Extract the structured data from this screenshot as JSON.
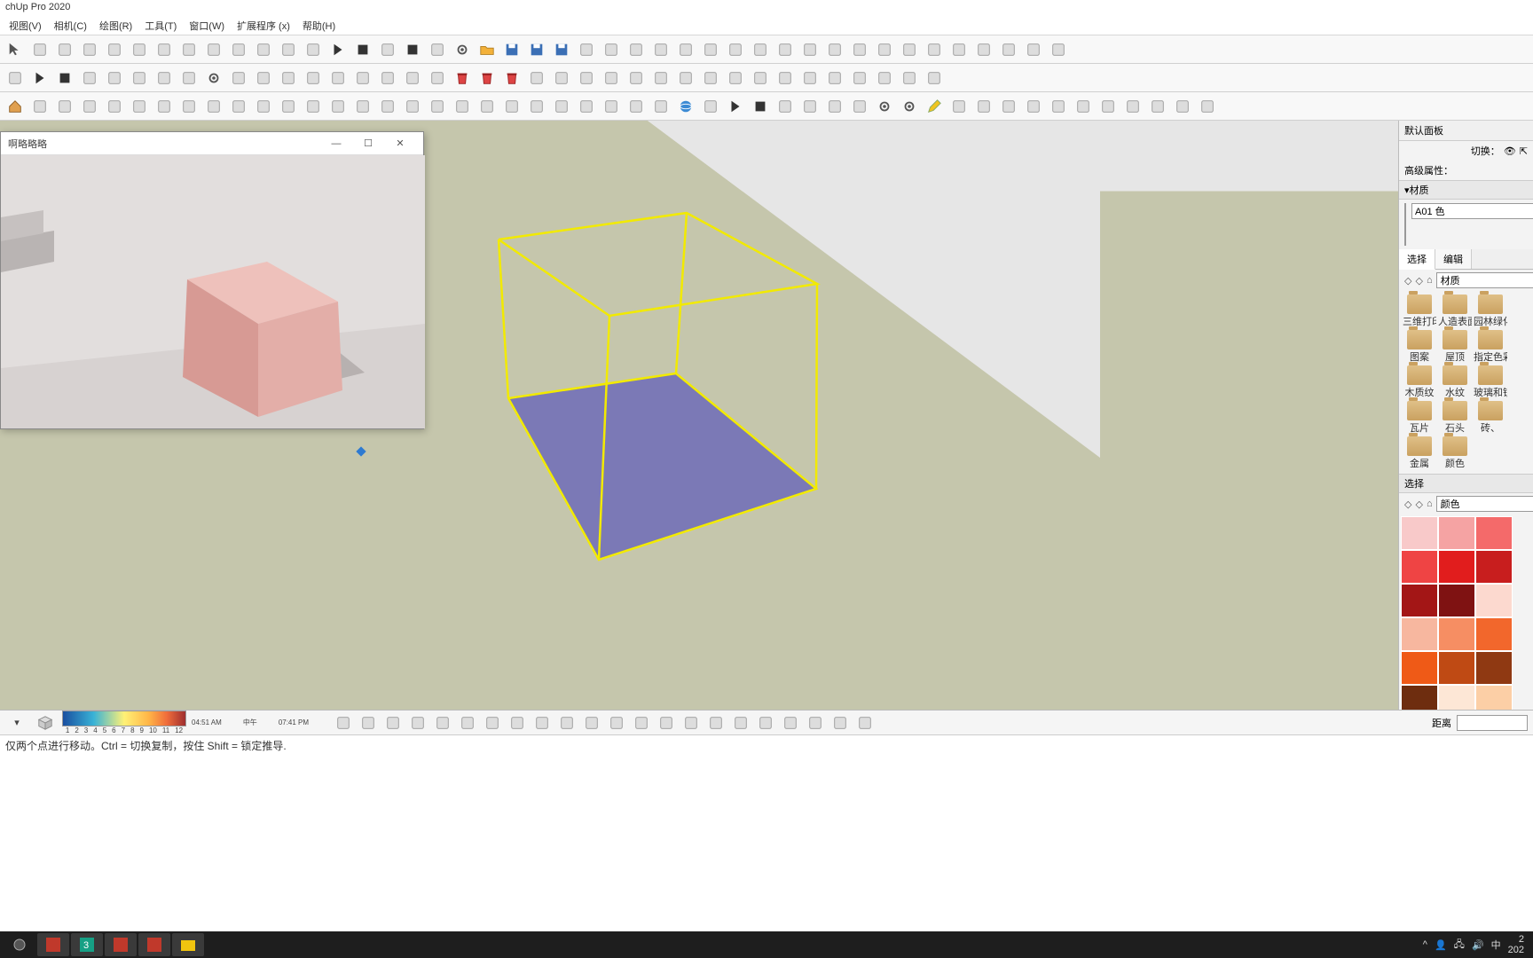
{
  "app": {
    "title": "chUp Pro 2020"
  },
  "menu": {
    "items": [
      "视图(V)",
      "相机(C)",
      "绘图(R)",
      "工具(T)",
      "窗口(W)",
      "扩展程序 (x)",
      "帮助(H)"
    ]
  },
  "toolbar_icons": {
    "row1": [
      "select",
      "lasso",
      "eraser",
      "scissors",
      "undo",
      "redo",
      "zoom-extents",
      "zoom",
      "pan",
      "orbit",
      "look",
      "walk",
      "lumion",
      "play",
      "stop",
      "record",
      "record-stop",
      "record-anim",
      "settings",
      "open",
      "save",
      "save-as",
      "save-copy",
      "new",
      "line",
      "rectangle",
      "push-pull",
      "circle",
      "arc",
      "pie",
      "offset",
      "follow-me",
      "dimension",
      "text",
      "section",
      "paint",
      "tape",
      "axes",
      "protractor",
      "rotate",
      "scale",
      "move",
      "esc"
    ],
    "row2": [
      "plugin-p",
      "play2",
      "stop2",
      "prev",
      "next",
      "sync",
      "fog",
      "shadows",
      "gear2",
      "cloud-dn",
      "cloud-up",
      "cloud-sel",
      "cloud-go",
      "box-red",
      "box-grn",
      "box-blu",
      "stack",
      "component",
      "trash-red",
      "trash-yel",
      "trash-gry",
      "swap",
      "package",
      "snowflake",
      "list",
      "bulb",
      "contrast",
      "blue-sq",
      "dashed",
      "hex-y",
      "hex-g",
      "hex-b",
      "grid4",
      "x-red",
      "x-blk",
      "cn-1",
      "cn-2",
      "cn-3"
    ],
    "row3": [
      "house",
      "refresh",
      "camera",
      "export-model",
      "render",
      "tree",
      "speaker-l",
      "speaker",
      "speaker-r",
      "equalizer",
      "tag",
      "info-wire",
      "info-fill",
      "sun",
      "info-i",
      "scene1",
      "scene2",
      "scene3",
      "exe",
      "code",
      "img-1",
      "img-2",
      "img-3",
      "img-stk",
      "slides",
      "slides2",
      "slides3",
      "globe",
      "flag-y",
      "play-o",
      "stop-o",
      "flag-end",
      "layer-up",
      "layer-dn",
      "layer-fit",
      "gear-o",
      "gear-p",
      "pencil",
      "wand",
      "paint2",
      "brush",
      "knife",
      "bucket",
      "cube-o",
      "move-o",
      "cut-o",
      "cross",
      "sel-box",
      "sel-dash"
    ]
  },
  "float_window": {
    "title": "啊略略略",
    "buttons": [
      "minimize",
      "maximize",
      "close"
    ]
  },
  "right_panel": {
    "default_tray": "默认面板",
    "toggle_label": "切换：",
    "adv_props": "高级属性：",
    "material_section": "材质",
    "material_name": "A01 色",
    "tabs": {
      "select": "选择",
      "edit": "编辑"
    },
    "browse_label": "材质",
    "folders": [
      "三维打印",
      "人造表面",
      "园林绿化",
      "图案",
      "屋顶",
      "指定色彩",
      "木质纹",
      "水纹",
      "玻璃和镜",
      "瓦片",
      "石头",
      "砖、",
      "金属",
      "颜色"
    ],
    "select2": "选择",
    "color_label": "颜色",
    "colors": [
      "#f8c9c9",
      "#f5a3a3",
      "#f46a6a",
      "#ef4444",
      "#e11d1d",
      "#c81e1e",
      "#a31616",
      "#7f1212",
      "#fcd9cf",
      "#f7b79f",
      "#f68e63",
      "#f2672c",
      "#ef5a17",
      "#bf4a14",
      "#8f3912",
      "#6e2d0f",
      "#fde7d6",
      "#fccfa6",
      "#f9b066",
      "#f79b3b"
    ]
  },
  "statusbar": {
    "time_left": "04:51 AM",
    "time_mid": "中午",
    "time_right": "07:41 PM",
    "ticks": [
      "1",
      "2",
      "3",
      "4",
      "5",
      "6",
      "7",
      "8",
      "9",
      "10",
      "11",
      "12"
    ]
  },
  "help_line": "仅两个点进行移动。Ctrl = 切换复制，按住 Shift = 锁定推导.",
  "distance_label": "距离",
  "taskbar": {
    "items": [
      "start",
      "vscode",
      "3dsmax",
      "sketchup",
      "su-doc",
      "explorer"
    ],
    "tray": {
      "net": "",
      "input": "中",
      "time": "2",
      "date": "202"
    }
  }
}
